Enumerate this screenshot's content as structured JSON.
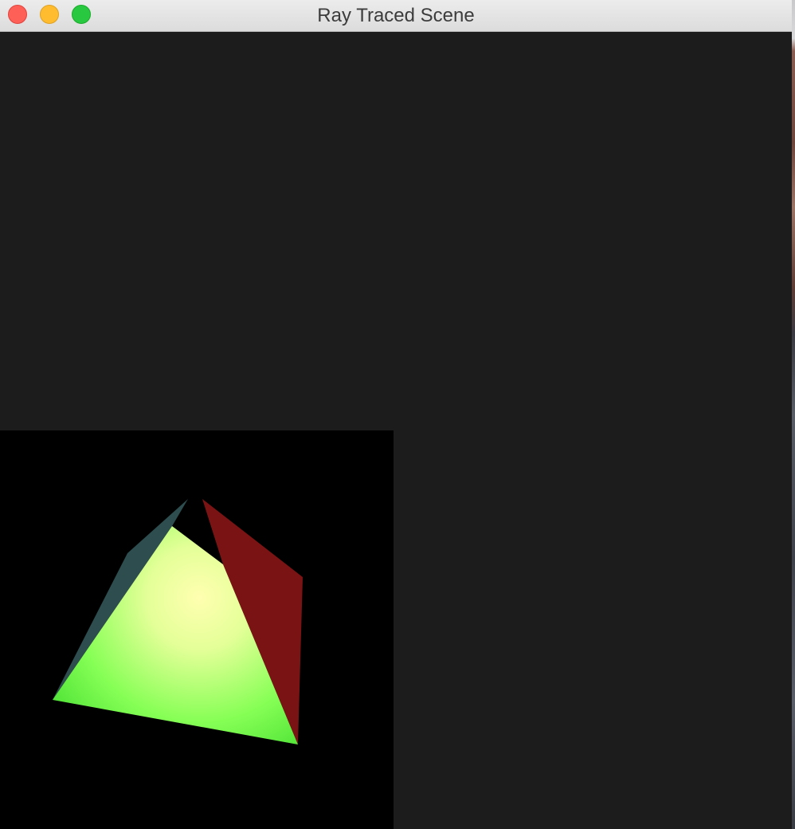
{
  "window": {
    "title": "Ray Traced Scene",
    "controls": {
      "close": "close-button",
      "minimize": "minimize-button",
      "zoom": "zoom-button"
    }
  },
  "scene": {
    "background_color": "#000000",
    "faces": [
      {
        "name": "front-face",
        "color_light": "#ffffb0",
        "color_dark": "#3ad82a"
      },
      {
        "name": "left-face",
        "color": "#2d4d4f"
      },
      {
        "name": "right-face",
        "color": "#7a1414"
      }
    ]
  },
  "colors": {
    "window_background": "#1c1c1c",
    "titlebar": "#e6e6e6",
    "close": "#fe5f57",
    "minimize": "#febc2e",
    "zoom": "#28c840"
  }
}
